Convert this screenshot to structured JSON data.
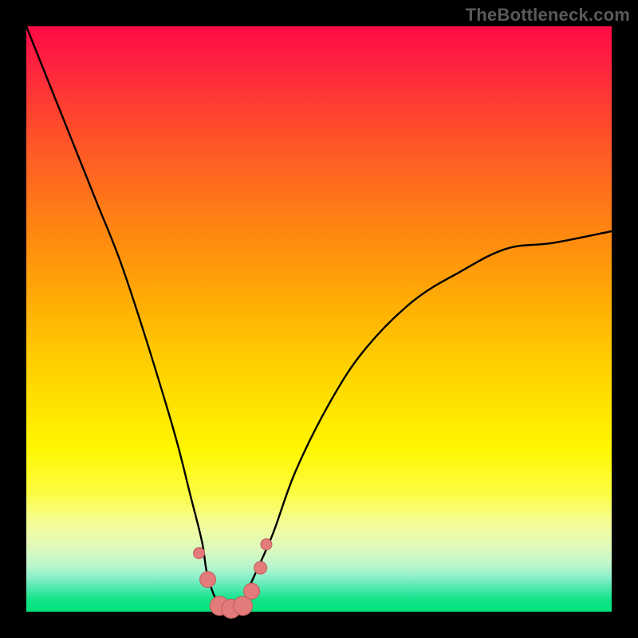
{
  "watermark": {
    "text": "TheBottleneck.com"
  },
  "chart_data": {
    "type": "line",
    "title": "",
    "xlabel": "",
    "ylabel": "",
    "xlim": [
      0,
      100
    ],
    "ylim": [
      0,
      100
    ],
    "grid": false,
    "legend": false,
    "series": [
      {
        "name": "bottleneck-curve",
        "x": [
          0,
          4,
          8,
          12,
          16,
          20,
          24,
          26,
          28,
          30,
          31,
          33,
          35,
          37,
          38,
          42,
          46,
          52,
          58,
          66,
          74,
          82,
          90,
          100
        ],
        "values": [
          100,
          90,
          80,
          70,
          60,
          48,
          35,
          28,
          20,
          12,
          6,
          1,
          0,
          1,
          4,
          13,
          24,
          36,
          45,
          53,
          58,
          62,
          63,
          65
        ]
      },
      {
        "name": "highlighted-points",
        "x": [
          29.5,
          31.0,
          33.0,
          35.0,
          37.0,
          38.5,
          40.0,
          41.0
        ],
        "values": [
          10.0,
          5.5,
          1.0,
          0.5,
          1.0,
          3.5,
          7.5,
          11.5
        ]
      }
    ],
    "colors": {
      "curve": "#000000",
      "marker_fill": "#e27b79",
      "marker_stroke": "#bd5f5d"
    }
  }
}
